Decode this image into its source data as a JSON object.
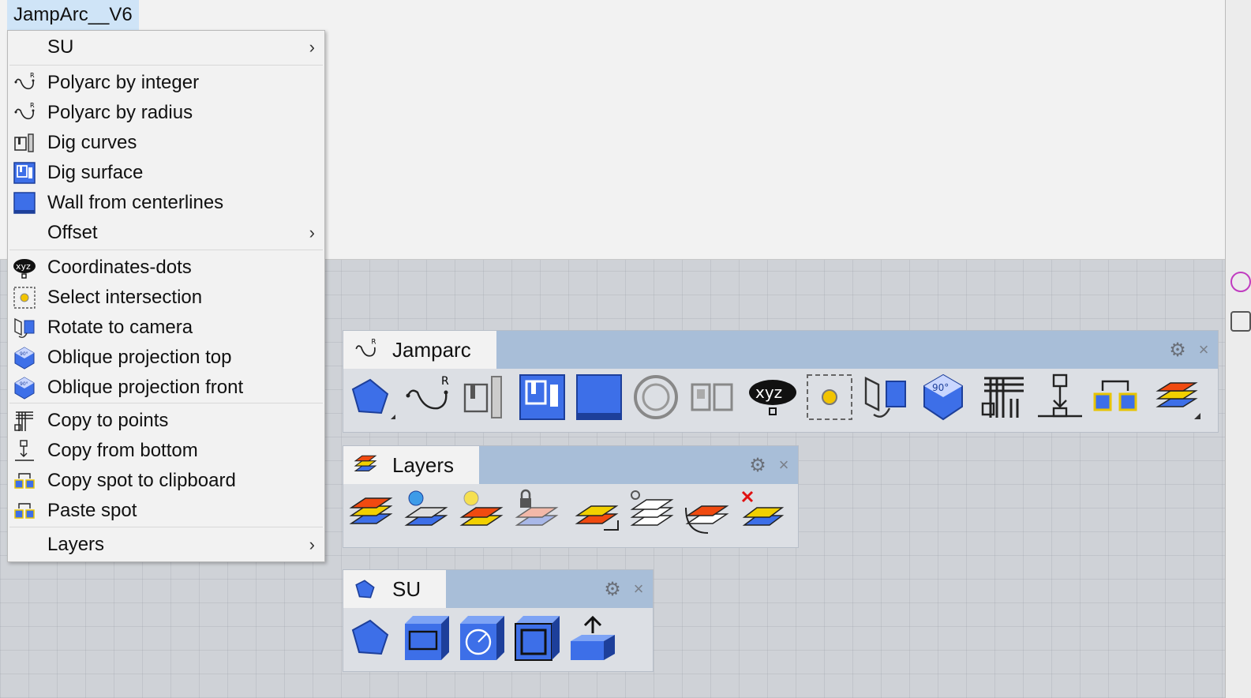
{
  "app": {
    "title": "JampArc__V6"
  },
  "menu": {
    "items": [
      {
        "label": "SU",
        "icon": "none",
        "submenu": true
      },
      {
        "label": "Polyarc by integer",
        "icon": "polyarc-icon"
      },
      {
        "label": "Polyarc by radius",
        "icon": "polyarc-radius-icon"
      },
      {
        "label": "Dig curves",
        "icon": "dig-curves-icon"
      },
      {
        "label": "Dig surface",
        "icon": "dig-surface-icon"
      },
      {
        "label": "Wall from centerlines",
        "icon": "wall-icon"
      },
      {
        "label": "Offset",
        "icon": "none",
        "submenu": true
      },
      {
        "label": "Coordinates-dots",
        "icon": "xyz-icon"
      },
      {
        "label": "Select intersection",
        "icon": "select-intersection-icon"
      },
      {
        "label": "Rotate to camera",
        "icon": "rotate-camera-icon"
      },
      {
        "label": "Oblique projection top",
        "icon": "oblique-top-icon"
      },
      {
        "label": "Oblique projection front",
        "icon": "oblique-front-icon"
      },
      {
        "label": "Copy to points",
        "icon": "copy-points-icon"
      },
      {
        "label": "Copy from bottom",
        "icon": "copy-bottom-icon"
      },
      {
        "label": "Copy spot to clipboard",
        "icon": "copy-spot-icon"
      },
      {
        "label": "Paste spot",
        "icon": "paste-spot-icon"
      },
      {
        "label": "Layers",
        "icon": "none",
        "submenu": true
      }
    ]
  },
  "toolbars": {
    "jamparc": {
      "title": "Jamparc",
      "button_count": 15
    },
    "layers": {
      "title": "Layers",
      "button_count": 8
    },
    "su": {
      "title": "SU",
      "button_count": 5
    }
  },
  "glyphs": {
    "arrow": "›",
    "gear": "⚙",
    "close": "×",
    "xyz": "xyz",
    "deg": "90°"
  },
  "colors": {
    "menu_bg": "#f2f2f2",
    "tab_highlight": "#cfe4f7",
    "toolbar_header": "#a8bed8",
    "icon_blue": "#3d6fe8"
  }
}
